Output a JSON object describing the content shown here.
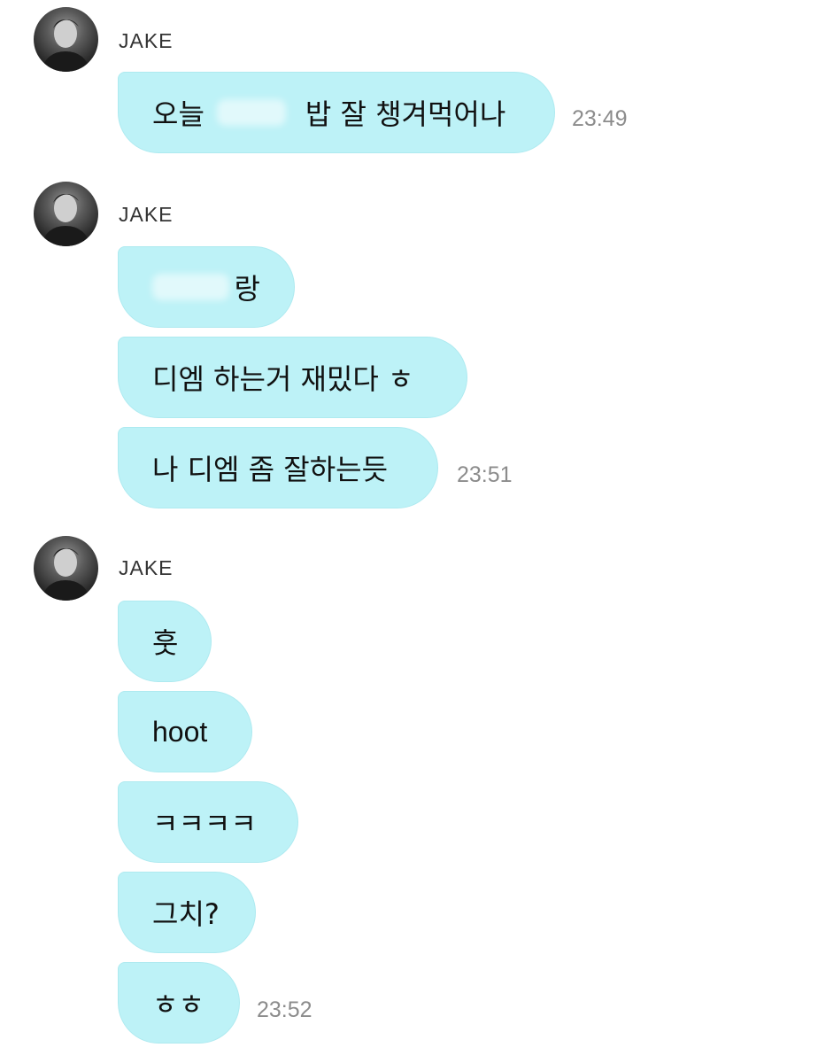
{
  "groups": [
    {
      "sender": "JAKE",
      "messages": [
        {
          "text_before": "오늘",
          "text_after": "밥 잘 챙겨먹어나"
        }
      ],
      "time": "23:49"
    },
    {
      "sender": "JAKE",
      "messages": [
        {
          "text": "랑"
        },
        {
          "text": "디엠 하는거 재밌다 ㅎ"
        },
        {
          "text": "나 디엠 좀 잘하는듯"
        }
      ],
      "time": "23:51"
    },
    {
      "sender": "JAKE",
      "messages": [
        {
          "text": "훗"
        },
        {
          "text": "hoot"
        },
        {
          "text": "ㅋㅋㅋㅋ"
        },
        {
          "text": "그치?"
        },
        {
          "text": "ㅎㅎ"
        }
      ],
      "time": "23:52"
    }
  ],
  "colors": {
    "bubble": "#bdf2f7",
    "timestamp": "#8c8c8c",
    "sender": "#333333"
  },
  "icons": {
    "avatar": "profile-photo"
  }
}
